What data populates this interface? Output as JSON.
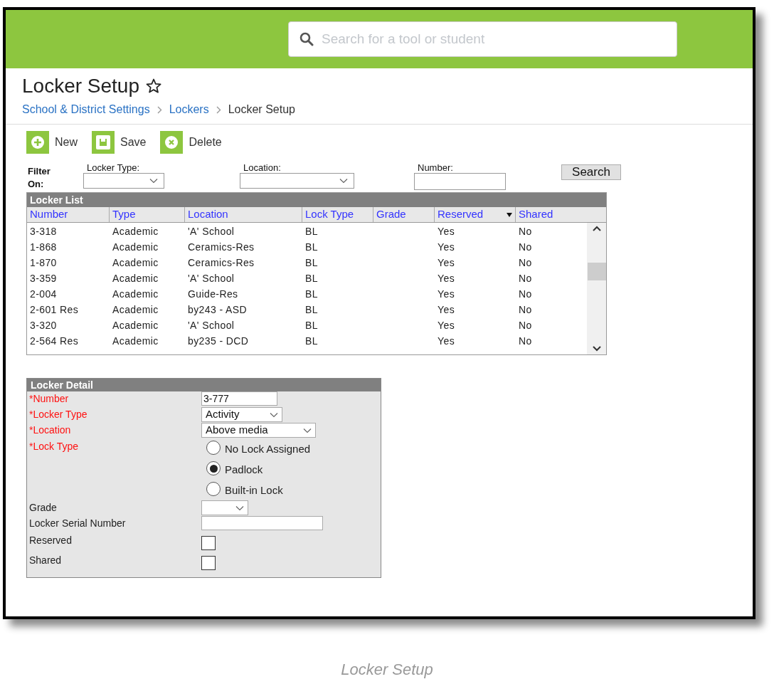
{
  "search": {
    "placeholder": "Search for a tool or student"
  },
  "page_title": "Locker Setup",
  "breadcrumb": [
    {
      "label": "School & District Settings",
      "link": true
    },
    {
      "label": "Lockers",
      "link": true
    },
    {
      "label": "Locker Setup",
      "link": false
    }
  ],
  "toolbar": [
    {
      "label": "New",
      "kind": "new"
    },
    {
      "label": "Save",
      "kind": "save"
    },
    {
      "label": "Delete",
      "kind": "delete"
    }
  ],
  "filter": {
    "label": "Filter On:",
    "fields": [
      {
        "label": "Locker Type:",
        "kind": "select"
      },
      {
        "label": "Location:",
        "kind": "select"
      },
      {
        "label": "Number:",
        "kind": "text"
      }
    ],
    "search_button": "Search"
  },
  "locker_list": {
    "title": "Locker List",
    "columns": [
      {
        "label": "Number",
        "sorted": false
      },
      {
        "label": "Type",
        "sorted": false
      },
      {
        "label": "Location",
        "sorted": false
      },
      {
        "label": "Lock Type",
        "sorted": false
      },
      {
        "label": "Grade",
        "sorted": false
      },
      {
        "label": "Reserved",
        "sorted": true
      },
      {
        "label": "Shared",
        "sorted": false
      }
    ],
    "rows": [
      [
        "3-318",
        "Academic",
        "'A' School",
        "BL",
        "",
        "Yes",
        "No"
      ],
      [
        "1-868",
        "Academic",
        "Ceramics-Res",
        "BL",
        "",
        "Yes",
        "No"
      ],
      [
        "1-870",
        "Academic",
        "Ceramics-Res",
        "BL",
        "",
        "Yes",
        "No"
      ],
      [
        "3-359",
        "Academic",
        "'A' School",
        "BL",
        "",
        "Yes",
        "No"
      ],
      [
        "2-004",
        "Academic",
        "Guide-Res",
        "BL",
        "",
        "Yes",
        "No"
      ],
      [
        "2-601 Res",
        "Academic",
        "by243 - ASD",
        "BL",
        "",
        "Yes",
        "No"
      ],
      [
        "3-320",
        "Academic",
        "'A' School",
        "BL",
        "",
        "Yes",
        "No"
      ],
      [
        "2-564 Res",
        "Academic",
        "by235 - DCD",
        "BL",
        "",
        "Yes",
        "No"
      ]
    ]
  },
  "locker_detail": {
    "title": "Locker Detail",
    "fields": [
      {
        "label": "*Number",
        "required": true,
        "kind": "text",
        "value": "3-777"
      },
      {
        "label": "*Locker Type",
        "required": true,
        "kind": "select",
        "value": "Activity"
      },
      {
        "label": "*Location",
        "required": true,
        "kind": "select",
        "value": "Above media"
      },
      {
        "label": "*Lock Type",
        "required": true,
        "kind": "radio",
        "options": [
          {
            "label": "No Lock Assigned",
            "selected": false
          },
          {
            "label": "Padlock",
            "selected": true
          },
          {
            "label": "Built-in Lock",
            "selected": false
          }
        ]
      },
      {
        "label": "Grade",
        "required": false,
        "kind": "select"
      },
      {
        "label": "Locker Serial Number",
        "required": false,
        "kind": "text"
      },
      {
        "label": "Reserved",
        "required": false,
        "kind": "checkbox",
        "checked": false
      },
      {
        "label": "Shared",
        "required": false,
        "kind": "checkbox",
        "checked": false
      }
    ]
  },
  "caption": "Locker Setup"
}
